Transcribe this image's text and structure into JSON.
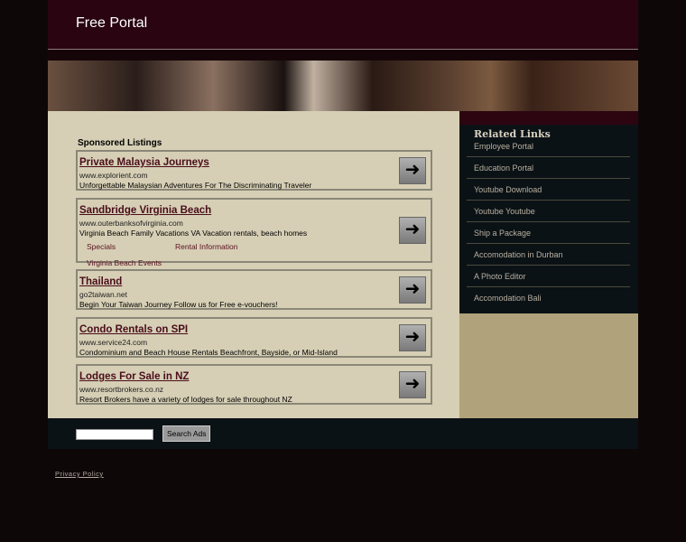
{
  "header": {
    "title": "Free Portal"
  },
  "sponsored": {
    "title": "Sponsored Listings",
    "ads": [
      {
        "title": "Private Malaysia Journeys",
        "url": "www.explorient.com",
        "desc": "Unforgettable Malaysian Adventures For The Discriminating Traveler"
      },
      {
        "title": "Sandbridge Virginia Beach",
        "url": "www.outerbanksofvirginia.com",
        "desc": "Virginia Beach Family Vacations VA Vacation rentals, beach homes",
        "sublinks": [
          "Specials",
          "Rental Information",
          "Virginia Beach Events"
        ]
      },
      {
        "title": "Thailand",
        "url": "go2taiwan.net",
        "desc": "Begin Your Taiwan Journey Follow us for Free e-vouchers!"
      },
      {
        "title": "Condo Rentals on SPI",
        "url": "www.service24.com",
        "desc": "Condominium and Beach House Rentals Beachfront, Bayside, or Mid-Island"
      },
      {
        "title": "Lodges For Sale in NZ",
        "url": "www.resortbrokers.co.nz",
        "desc": "Resort Brokers have a variety of lodges for sale throughout NZ"
      }
    ]
  },
  "related": {
    "title": "Related Links",
    "items": [
      "Employee Portal",
      "Education Portal",
      "Youtube Download",
      "Youtube Youtube",
      "Ship a Package",
      "Accomodation in Durban",
      "A Photo Editor",
      "Accomodation Bali"
    ]
  },
  "footer": {
    "search_value": "",
    "search_button": "Search Ads",
    "privacy": "Privacy Policy"
  }
}
